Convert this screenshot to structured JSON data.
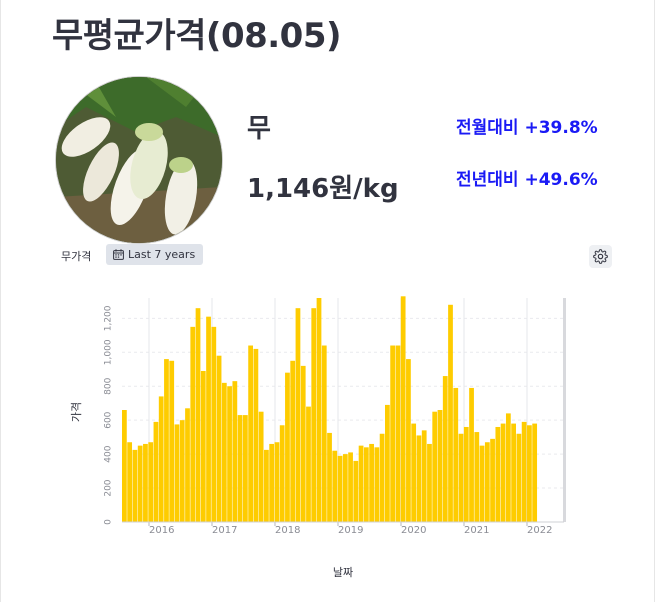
{
  "header": {
    "title": "무평균가격(08.05)"
  },
  "product": {
    "name": "무",
    "price": "1,146원/kg",
    "mom_change": "전월대비 +39.8%",
    "yoy_change": "전년대비 +49.6%",
    "image_icon": "radish-photo"
  },
  "chart_controls": {
    "label": "무가격",
    "range_label": "Last 7 years",
    "range_icon": "calendar-icon",
    "settings_icon": "gear-icon"
  },
  "chart_data": {
    "type": "bar",
    "xlabel": "날짜",
    "ylabel": "가격",
    "ylim": [
      0,
      1320
    ],
    "yticks": [
      0,
      200,
      400,
      600,
      800,
      1000,
      1200
    ],
    "yticklabels": [
      "0",
      "200",
      "400",
      "600",
      "800",
      "1,000",
      "1,200"
    ],
    "xticklabels": [
      "2016",
      "2017",
      "2018",
      "2019",
      "2020",
      "2021",
      "2022"
    ],
    "bar_color": "#fecc00",
    "start_label": "2015-06",
    "interval": "monthly",
    "values": [
      660,
      470,
      425,
      450,
      460,
      470,
      590,
      740,
      960,
      950,
      575,
      600,
      670,
      1150,
      1260,
      890,
      1210,
      1150,
      980,
      820,
      800,
      830,
      630,
      630,
      1040,
      1020,
      650,
      425,
      460,
      470,
      570,
      880,
      950,
      1260,
      920,
      680,
      1260,
      1320,
      1040,
      525,
      420,
      390,
      400,
      410,
      360,
      450,
      440,
      460,
      440,
      520,
      690,
      1040,
      1040,
      1330,
      960,
      580,
      510,
      540,
      460,
      650,
      660,
      860,
      1280,
      790,
      520,
      560,
      790,
      530,
      450,
      470,
      490,
      560,
      580,
      640,
      580,
      520,
      590,
      570,
      580
    ]
  }
}
